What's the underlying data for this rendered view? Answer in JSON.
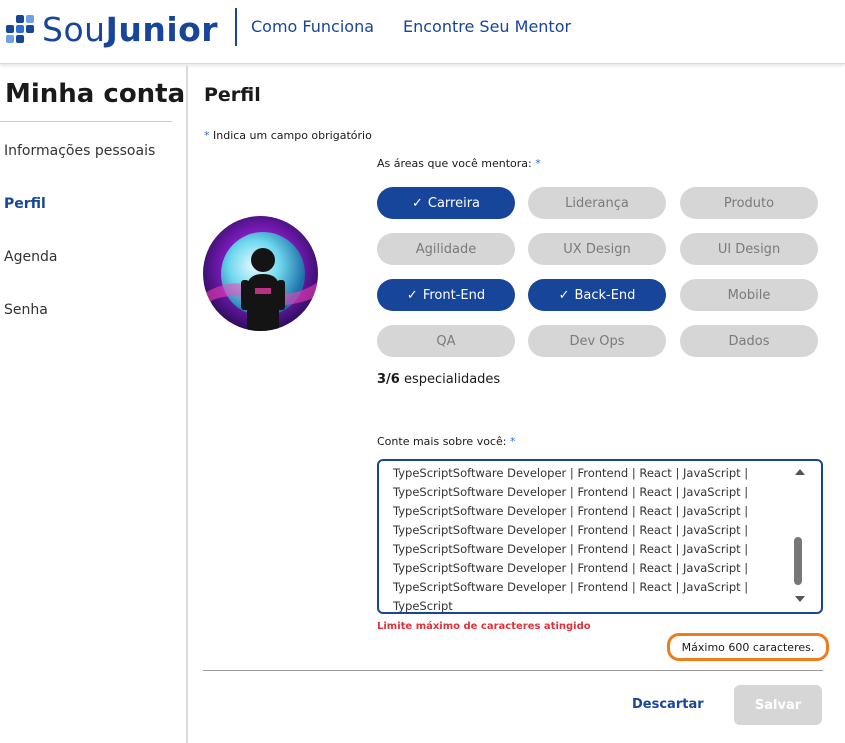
{
  "header": {
    "brand_light": "Sou",
    "brand_bold": "Junior",
    "nav": [
      "Como Funciona",
      "Encontre Seu Mentor"
    ],
    "brand_color": "#17459a"
  },
  "sidebar": {
    "title": "Minha conta",
    "items": [
      {
        "label": "Informações pessoais",
        "active": false
      },
      {
        "label": "Perfil",
        "active": true
      },
      {
        "label": "Agenda",
        "active": false
      },
      {
        "label": "Senha",
        "active": false
      }
    ]
  },
  "main": {
    "title": "Perfil",
    "required_star": "*",
    "required_note": "Indica um campo obrigatório",
    "avatar_icon": "astronaut-avatar",
    "areas_label": "As áreas que você mentora:",
    "chips": [
      {
        "label": "Carreira",
        "selected": true
      },
      {
        "label": "Liderança",
        "selected": false
      },
      {
        "label": "Produto",
        "selected": false
      },
      {
        "label": "Agilidade",
        "selected": false
      },
      {
        "label": "UX Design",
        "selected": false
      },
      {
        "label": "UI Design",
        "selected": false
      },
      {
        "label": "Front-End",
        "selected": true
      },
      {
        "label": "Back-End",
        "selected": true
      },
      {
        "label": "Mobile",
        "selected": false
      },
      {
        "label": "QA",
        "selected": false
      },
      {
        "label": "Dev Ops",
        "selected": false
      },
      {
        "label": "Dados",
        "selected": false
      }
    ],
    "check_glyph": "✓",
    "count_value": "3/6",
    "count_suffix": "especialidades",
    "about_label": "Conte mais sobre você:",
    "about_lines": [
      "TypeScriptSoftware Developer | Frontend | React | JavaScript |",
      "TypeScriptSoftware Developer | Frontend | React | JavaScript |",
      "TypeScriptSoftware Developer | Frontend | React | JavaScript |",
      "TypeScriptSoftware Developer | Frontend | React | JavaScript |",
      "TypeScriptSoftware Developer | Frontend | React | JavaScript |",
      "TypeScriptSoftware Developer | Frontend | React | JavaScript |",
      "TypeScriptSoftware Developer | Frontend | React | JavaScript |",
      "TypeScript"
    ],
    "limit_message": "Limite máximo de caracteres atingido",
    "max_chars": "Máximo 600 caracteres.",
    "discard_label": "Descartar",
    "save_label": "Salvar",
    "colors": {
      "accent": "#17459a",
      "chip_off": "#d6d6d6",
      "error": "#e0313a",
      "highlight": "#f07b1a"
    }
  }
}
